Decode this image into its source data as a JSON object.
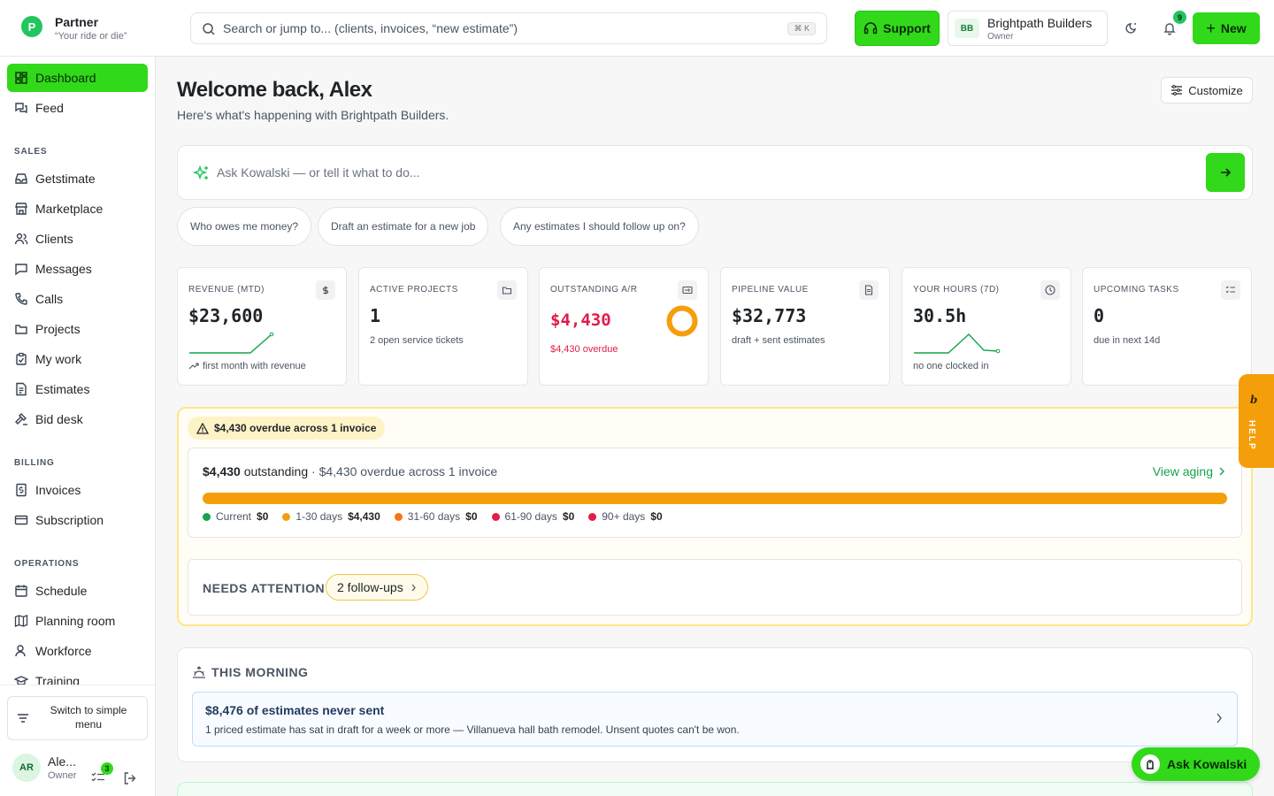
{
  "brand": {
    "name": "Partner",
    "tagline": "“Your ride or die”",
    "logo_letter": "P"
  },
  "search": {
    "placeholder": "Search or jump to... (clients, invoices, “new estimate”)",
    "shortcut": "⌘ K"
  },
  "topbar": {
    "support_label": "Support",
    "org": {
      "initials": "BB",
      "name": "Brightpath Builders",
      "role": "Owner"
    },
    "notifications_count": "9",
    "new_label": "New"
  },
  "sidebar": {
    "primary": [
      {
        "label": "Dashboard",
        "icon": "dashboard-icon",
        "active": true
      },
      {
        "label": "Feed",
        "icon": "feed-icon"
      }
    ],
    "sections": [
      {
        "title": "SALES",
        "items": [
          {
            "label": "Getstimate",
            "icon": "inbox-icon"
          },
          {
            "label": "Marketplace",
            "icon": "store-icon"
          },
          {
            "label": "Clients",
            "icon": "users-icon"
          },
          {
            "label": "Messages",
            "icon": "message-icon"
          },
          {
            "label": "Calls",
            "icon": "phone-icon"
          },
          {
            "label": "Projects",
            "icon": "folder-icon"
          },
          {
            "label": "My work",
            "icon": "clipboard-icon"
          },
          {
            "label": "Estimates",
            "icon": "document-icon"
          },
          {
            "label": "Bid desk",
            "icon": "gavel-icon"
          }
        ]
      },
      {
        "title": "BILLING",
        "items": [
          {
            "label": "Invoices",
            "icon": "invoice-icon"
          },
          {
            "label": "Subscription",
            "icon": "card-icon"
          }
        ]
      },
      {
        "title": "OPERATIONS",
        "items": [
          {
            "label": "Schedule",
            "icon": "calendar-icon"
          },
          {
            "label": "Planning room",
            "icon": "map-icon"
          },
          {
            "label": "Workforce",
            "icon": "workforce-icon"
          },
          {
            "label": "Training",
            "icon": "graduation-icon"
          }
        ]
      }
    ],
    "switch_label": "Switch to simple menu",
    "user": {
      "initials": "AR",
      "name": "Ale...",
      "role": "Owner",
      "tasks_count": "3"
    }
  },
  "main": {
    "welcome": "Welcome back, Alex",
    "subtitle": "Here's what's happening with Brightpath Builders.",
    "customize_label": "Customize",
    "ask_placeholder": "Ask Kowalski — or tell it what to do...",
    "chips": [
      "Who owes me money?",
      "Draft an estimate for a new job",
      "Any estimates I should follow up on?"
    ],
    "cards": [
      {
        "label": "REVENUE (MTD)",
        "value": "$23,600",
        "sub": "first month with revenue",
        "icon": "dollar-icon"
      },
      {
        "label": "ACTIVE PROJECTS",
        "value": "1",
        "sub": "2 open service tickets",
        "icon": "folder-icon"
      },
      {
        "label": "OUTSTANDING A/R",
        "value": "$4,430",
        "sub": "$4,430 overdue",
        "icon": "receivable-icon"
      },
      {
        "label": "PIPELINE VALUE",
        "value": "$32,773",
        "sub": "draft + sent estimates",
        "icon": "document-icon"
      },
      {
        "label": "YOUR HOURS (7D)",
        "value": "30.5h",
        "sub": "no one clocked in",
        "icon": "clock-icon"
      },
      {
        "label": "UPCOMING TASKS",
        "value": "0",
        "sub": "due in next 14d",
        "icon": "checklist-icon"
      }
    ],
    "ar": {
      "warning": "$4,430 overdue across 1 invoice",
      "outstanding": "$4,430",
      "outstanding_word": "outstanding",
      "detail": "· $4,430 overdue across 1 invoice",
      "view_aging": "View aging",
      "buckets": [
        {
          "label": "Current",
          "amount": "$0",
          "color": "#16a34a"
        },
        {
          "label": "1-30 days",
          "amount": "$4,430",
          "color": "#f59e0b"
        },
        {
          "label": "31-60 days",
          "amount": "$0",
          "color": "#f97316"
        },
        {
          "label": "61-90 days",
          "amount": "$0",
          "color": "#e11d48"
        },
        {
          "label": "90+ days",
          "amount": "$0",
          "color": "#e11d48"
        }
      ],
      "overdue_share": 1.0
    },
    "attention": {
      "label": "NEEDS ATTENTION",
      "followups": "2 follow-ups"
    },
    "morning": {
      "title": "THIS MORNING",
      "insight_title": "$8,476 of estimates never sent",
      "insight_text": "1 priced estimate has sat in draft for a week or more — Villanueva hall bath remodel. Unsent quotes can't be won."
    }
  },
  "help_label": "HELP",
  "help_badge": "b",
  "ask_kowalski_label": "Ask Kowalski",
  "colors": {
    "accent": "#31d91a",
    "overdue": "#e11d48",
    "warning": "#f59e0b",
    "sparkline": "#16a34a"
  }
}
